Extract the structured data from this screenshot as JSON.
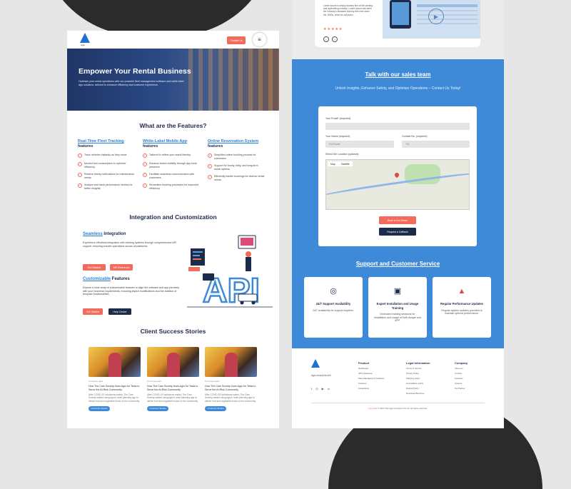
{
  "colors": {
    "accent": "#f26b5b",
    "brand_blue": "#3f8ad8",
    "navy": "#1c2b4a",
    "link_blue": "#2a82d6"
  },
  "left": {
    "header": {
      "logo_text": "Agio",
      "contact_label": "Contact Us",
      "menu_icon": "hamburger-icon"
    },
    "hero": {
      "title": "Empower Your Rental Business",
      "subtitle": "Optimize your rental operations with our powerful fleet management software and white-label app solutions, tailored to enhance efficiency and customer experience."
    },
    "features": {
      "title": "What are the Features?",
      "columns": [
        {
          "title_hl": "Real-Time Fleet Tracking",
          "title_rest": " features",
          "items": [
            "Track vehicles instantly as they move.",
            "Monitor fuel consumption to optimize efficiency.",
            "Receive timely notifications for maintenance needs.",
            "Analyze and track performance metrics for better insights."
          ]
        },
        {
          "title_hl": "White-Label Mobile App",
          "title_rest": " features",
          "items": [
            "Tailored to reflect your brand identity.",
            "Enhance brand visibility through app store presence.",
            "Facilitate seamless communication with customers.",
            "Streamline booking processes for improved efficiency."
          ]
        },
        {
          "title_hl": "Online Reservation System",
          "title_rest": " features",
          "items": [
            "Simplified online booking process for customers.",
            "Support for hourly, daily, and long-term rental options.",
            "Efficiently handle bookings for diverse rental needs."
          ]
        }
      ]
    },
    "integration": {
      "title": "Integration and Customization",
      "seamless": {
        "hl": "Seamless",
        "rest": " Integration",
        "text": "Experience effortless integration with existing systems through comprehensive API support, ensuring smooth operations across all platforms.",
        "btn1": "Get Started",
        "btn2": "API Reference"
      },
      "custom": {
        "hl": "Customizable",
        "rest": " Features",
        "text": "Explore a wide array of customizable features to align the software and app precisely with your business requirements, including stylish modifications and the addition of bespoke functionalities.",
        "btn1": "Get Started",
        "btn2": "Help Center"
      },
      "illustration_label": "API"
    },
    "stories": {
      "title": "Client Success Stories",
      "items": [
        {
          "meta": "5 minutes read",
          "title": "How The Cars Society Uses Agio for Tesla to Serve the At-Risk Community",
          "body": "After COVID-19 lockdowns ended, The Cars Society started using Agio's route planning app to deliver fruit and vegetable boxes to the community.",
          "btn": "Customer Stories"
        },
        {
          "meta": "5 minutes read",
          "title": "How The Cars Society Uses Agio for Tesla to Serve the At-Risk Community",
          "body": "After COVID-19 lockdowns ended, The Cars Society started using Agio's route planning app to deliver fruit and vegetable boxes to the community.",
          "btn": "Customer Stories"
        },
        {
          "meta": "5 minutes read",
          "title": "How The Cars Society Uses Agio for Tesla to Serve the At-Risk Community",
          "body": "After COVID-19 lockdowns ended, The Cars Society started using Agio's route planning app to deliver fruit and vegetable boxes to the community.",
          "btn": "Customer Stories"
        }
      ]
    }
  },
  "right": {
    "review": {
      "text": "Lorem ipsum is simply dummy text of the printing and typesetting industry. Lorem Ipsum has been the industry's standard dummy text ever since the 1500s, when an unknown.",
      "stars": "★★★★★",
      "prev": "‹",
      "next": "›"
    },
    "talk": {
      "title": "Talk with our sales team",
      "subtitle": "Unlock Insights, Enhance Safety, and Optimize Operations – Contact Us Today!"
    },
    "form": {
      "email_label": "Your Email* (required)",
      "name_label": "Your Name (required)",
      "contact_label": "Contact No. (required)",
      "name_placeholder": "Full Name",
      "country_code": "+91",
      "location_label": "Select the Location (optional)",
      "map_tab": "Map",
      "sat_tab": "Satellite",
      "btn_demo": "Book a Live Demo",
      "btn_callback": "Request a Callback"
    },
    "support": {
      "title": "Support and Customer Service",
      "cards": [
        {
          "icon": "24-7-icon",
          "glyph": "◎",
          "title": "24/7 Support Availability",
          "desc": "24/7 availability for support inquiries."
        },
        {
          "icon": "training-icon",
          "glyph": "▣",
          "title": "Expert Installation and Usage Training",
          "desc": "Dedicated training sessions for installation and usage of both dongle and APP."
        },
        {
          "icon": "performance-icon",
          "glyph": "▲",
          "title": "Regular Performance Updates",
          "desc": "Regular system updates provided to maintain optimal performance."
        }
      ]
    },
    "footer": {
      "tagline": "Agio knows the drill",
      "social": [
        "f",
        "◎",
        "▶",
        "in"
      ],
      "cols": [
        {
          "head": "Product",
          "items": [
            "Dashboard",
            "GPS Hardware",
            "Fleet Management Software",
            "Features",
            "Integrations"
          ]
        },
        {
          "head": "Legal Information",
          "items": [
            "Terms of Service",
            "Privacy Policy",
            "Shipping policy",
            "Cancellation policy",
            "Refund Policy",
            "Download Brochure"
          ]
        },
        {
          "head": "Company",
          "items": [
            "About us",
            "Contact",
            "Features",
            "Careers",
            "For Partner"
          ]
        }
      ],
      "copyright_pre": "Copyright",
      "copyright_rest": " © 2024 The Agio Company Pvt Ltd. All rights reserved."
    }
  }
}
